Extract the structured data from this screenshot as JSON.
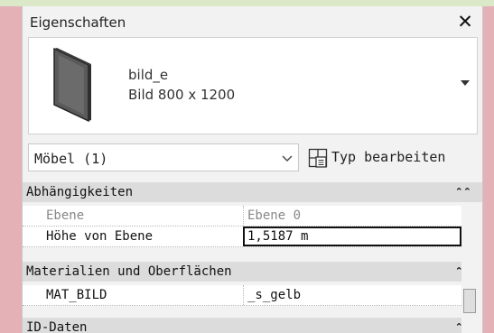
{
  "panel": {
    "title": "Eigenschaften",
    "close_symbol": "✕"
  },
  "type_selector": {
    "family_name": "bild_e",
    "type_name": "Bild 800 x 1200",
    "preview_icon": "picture-frame-icon",
    "dropdown_icon": "dropdown-arrow-icon"
  },
  "category_filter": {
    "label": "Möbel (1)",
    "chevron_icon": "chevron-down-icon"
  },
  "edit_type": {
    "label": "Typ bearbeiten",
    "icon": "edit-type-icon"
  },
  "groups": [
    {
      "label": "Abhängigkeiten",
      "collapse_symbol": "⌃⌃",
      "rows": [
        {
          "name": "Ebene",
          "value": "Ebene 0",
          "dimmed": true
        },
        {
          "name": "Höhe von Ebene",
          "value": "1,5187 m",
          "editing": true
        }
      ]
    },
    {
      "label": "Materialien und Oberflächen",
      "collapse_symbol": "⌃⌃",
      "rows": [
        {
          "name": "MAT_BILD",
          "value": "_s_gelb"
        }
      ]
    },
    {
      "label": "ID-Daten",
      "collapse_symbol": "⌃⌃",
      "rows": []
    }
  ],
  "colors": {
    "background": "#e3b1b6",
    "top_strip": "#dbe9c9",
    "panel": "#f2f2f2",
    "group_header": "#dcdcdc"
  }
}
